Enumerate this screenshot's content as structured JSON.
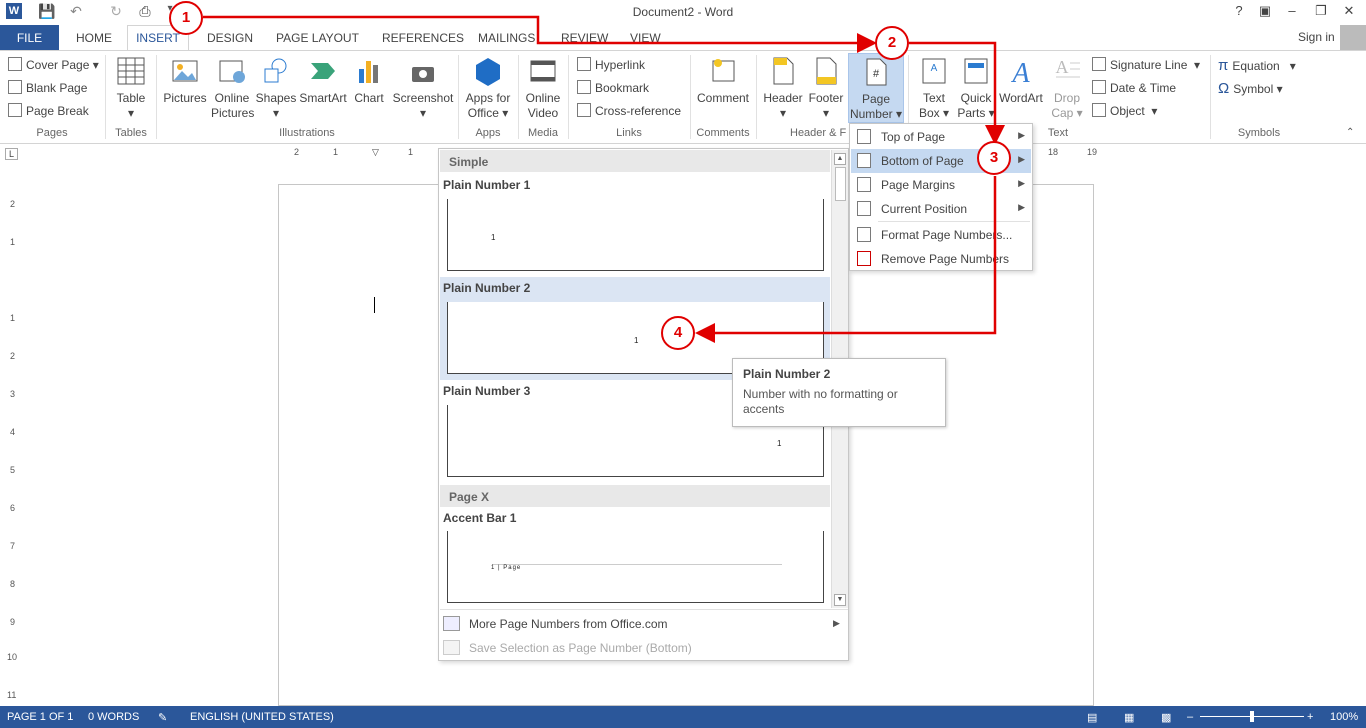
{
  "window": {
    "title": "Document2 - Word",
    "help": "?"
  },
  "tabs": [
    "FILE",
    "HOME",
    "INSERT",
    "DESIGN",
    "PAGE LAYOUT",
    "REFERENCES",
    "MAILINGS",
    "REVIEW",
    "VIEW"
  ],
  "signin": "Sign in",
  "ribbon": {
    "pages": {
      "cover": "Cover Page",
      "blank": "Blank Page",
      "break": "Page Break",
      "label": "Pages"
    },
    "tables": {
      "table": "Table",
      "label": "Tables"
    },
    "illustrations": {
      "pictures": "Pictures",
      "online1": "Online",
      "online2": "Pictures",
      "shapes": "Shapes",
      "smartart": "SmartArt",
      "chart": "Chart",
      "screenshot": "Screenshot",
      "label": "Illustrations"
    },
    "apps": {
      "l1": "Apps for",
      "l2": "Office",
      "label": "Apps"
    },
    "media": {
      "l1": "Online",
      "l2": "Video",
      "label": "Media"
    },
    "links": {
      "hyperlink": "Hyperlink",
      "bookmark": "Bookmark",
      "crossref": "Cross-reference",
      "label": "Links"
    },
    "comments": {
      "comment": "Comment",
      "label": "Comments"
    },
    "hf": {
      "header": "Header",
      "footer": "Footer",
      "pn1": "Page",
      "pn2": "Number",
      "label": "Header & F"
    },
    "text": {
      "tb1": "Text",
      "tb2": "Box",
      "qp1": "Quick",
      "qp2": "Parts",
      "wordart": "WordArt",
      "dc1": "Drop",
      "dc2": "Cap",
      "sig": "Signature Line",
      "date": "Date & Time",
      "object": "Object",
      "label": "Text"
    },
    "symbols": {
      "equation": "Equation",
      "symbol": "Symbol",
      "label": "Symbols"
    }
  },
  "ruler": {
    "h": [
      "2",
      "1",
      "1",
      "18",
      "19"
    ],
    "v": [
      "2",
      "1",
      "1",
      "1",
      "2",
      "3",
      "4",
      "5",
      "6",
      "7",
      "8",
      "9",
      "10",
      "11"
    ]
  },
  "gallery": {
    "section_simple": "Simple",
    "pn1_title": "Plain Number 1",
    "pn2_title": "Plain Number 2",
    "pn3_title": "Plain Number 3",
    "section_pagex": "Page X",
    "ab1_title": "Accent Bar 1",
    "sample_num": "1",
    "accent_text": "1 | Page",
    "more": "More Page Numbers from Office.com",
    "save": "Save Selection as Page Number (Bottom)"
  },
  "submenu": {
    "top": "Top of Page",
    "bottom": "Bottom of Page",
    "margins": "Page Margins",
    "current": "Current Position",
    "format": "Format Page Numbers...",
    "remove": "Remove Page Numbers"
  },
  "tooltip": {
    "title": "Plain Number 2",
    "desc": "Number with no formatting or accents"
  },
  "status": {
    "page": "PAGE 1 OF 1",
    "words": "0 WORDS",
    "lang": "ENGLISH (UNITED STATES)",
    "zoom": "100%"
  },
  "callouts": [
    "1",
    "2",
    "3",
    "4"
  ],
  "colors": {
    "accent": "#2b579a",
    "annotation": "#e00000",
    "hover": "#c5d9f1"
  }
}
